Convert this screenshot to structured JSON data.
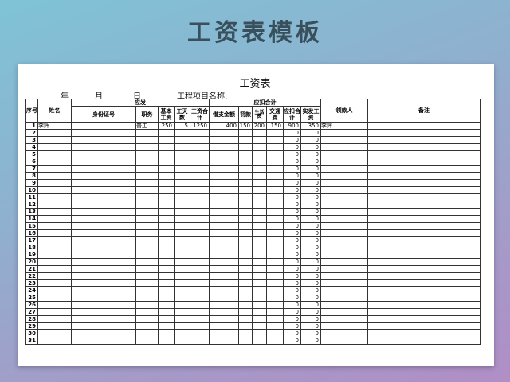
{
  "banner": {
    "title": "工资表模板"
  },
  "sheet": {
    "title": "工资表",
    "date_year": "年",
    "date_month": "月",
    "date_day": "日",
    "project_label": "工程项目名称:"
  },
  "headers": {
    "seq": "序号",
    "name": "姓名",
    "group_pay": "应发",
    "group_deduct": "应扣合计",
    "id_no": "身份证号",
    "position": "职务",
    "base_wage": "基本工资",
    "work_days": "工天数",
    "wage_total": "工资合计",
    "advance": "借支金额",
    "fine": "罚款",
    "living": "生活费",
    "transport": "交通费",
    "deduct_total": "应扣合计",
    "net_pay": "实发工资",
    "recipient": "领款人",
    "remarks": "备注"
  },
  "rows": [
    {
      "seq": "1",
      "name": "李辉",
      "position": "普工",
      "base": "250",
      "days": "5",
      "total": "1250",
      "advance": "400",
      "fine": "150",
      "living": "200",
      "transport": "150",
      "deduct": "900",
      "net": "350",
      "recipient": "李辉"
    },
    {
      "seq": "2",
      "deduct": "0",
      "net": "0"
    },
    {
      "seq": "3",
      "deduct": "0",
      "net": "0"
    },
    {
      "seq": "4",
      "deduct": "0",
      "net": "0"
    },
    {
      "seq": "5",
      "deduct": "0",
      "net": "0"
    },
    {
      "seq": "6",
      "deduct": "0",
      "net": "0"
    },
    {
      "seq": "7",
      "deduct": "0",
      "net": "0"
    },
    {
      "seq": "8",
      "deduct": "0",
      "net": "0"
    },
    {
      "seq": "9",
      "deduct": "0",
      "net": "0"
    },
    {
      "seq": "10",
      "deduct": "0",
      "net": "0"
    },
    {
      "seq": "11",
      "deduct": "0",
      "net": "0"
    },
    {
      "seq": "12",
      "deduct": "0",
      "net": "0"
    },
    {
      "seq": "13",
      "deduct": "0",
      "net": "0"
    },
    {
      "seq": "14",
      "deduct": "0",
      "net": "0"
    },
    {
      "seq": "15",
      "deduct": "0",
      "net": "0"
    },
    {
      "seq": "16",
      "deduct": "0",
      "net": "0"
    },
    {
      "seq": "17",
      "deduct": "0",
      "net": "0"
    },
    {
      "seq": "18",
      "deduct": "0",
      "net": "0"
    },
    {
      "seq": "19",
      "deduct": "0",
      "net": "0"
    },
    {
      "seq": "20",
      "deduct": "0",
      "net": "0"
    },
    {
      "seq": "21",
      "deduct": "0",
      "net": "0"
    },
    {
      "seq": "22",
      "deduct": "0",
      "net": "0"
    },
    {
      "seq": "23",
      "deduct": "0",
      "net": "0"
    },
    {
      "seq": "24",
      "deduct": "0",
      "net": "0"
    },
    {
      "seq": "25",
      "deduct": "0",
      "net": "0"
    },
    {
      "seq": "26",
      "deduct": "0",
      "net": "0"
    },
    {
      "seq": "27",
      "deduct": "0",
      "net": "0"
    },
    {
      "seq": "28",
      "deduct": "0",
      "net": "0"
    },
    {
      "seq": "29",
      "deduct": "0",
      "net": "0"
    },
    {
      "seq": "30",
      "deduct": "0",
      "net": "0"
    },
    {
      "seq": "31",
      "deduct": "0",
      "net": "0"
    }
  ],
  "colors": {
    "background_top": "#7fc3d6",
    "background_bottom": "#b08ec6",
    "banner_text": "#39505c",
    "sheet": "#ffffff"
  }
}
